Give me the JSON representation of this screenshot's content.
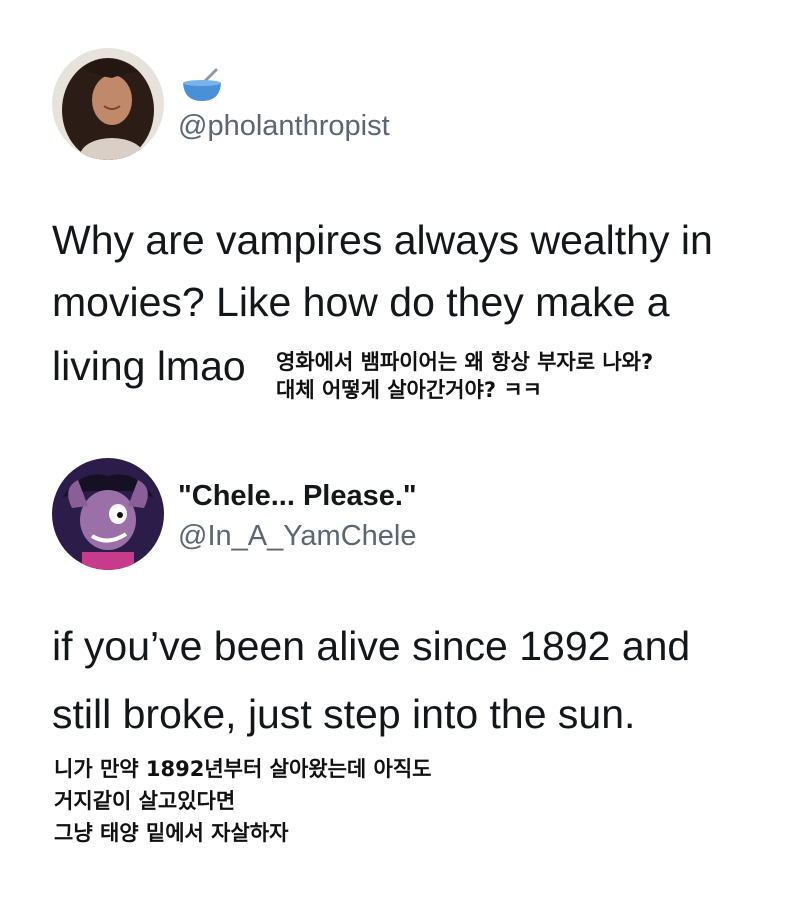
{
  "tweet1": {
    "handle": "@pholanthropist",
    "emoji_icon": "bowl-with-spoon-icon",
    "lines": [
      "Why are vampires always wealthy in",
      "movies? Like how do they make a",
      "living lmao"
    ],
    "translation": [
      "영화에서 뱀파이어는 왜 항상 부자로 나와?",
      "대체 어떻게 살아간거야? ㅋㅋ"
    ]
  },
  "tweet2": {
    "display_name": "\"Chele... Please.\"",
    "handle": "@In_A_YamChele",
    "lines": [
      "if you’ve been alive since 1892 and",
      "still broke, just step into the sun."
    ],
    "translation": [
      "니가 만약 1892년부터 살아왔는데 아직도",
      "거지같이 살고있다면",
      "그냥 태양 밑에서 자살하자"
    ]
  },
  "colors": {
    "text": "#14171a",
    "handle": "#5b6670",
    "emoji_bowl": "#4a90d9"
  }
}
